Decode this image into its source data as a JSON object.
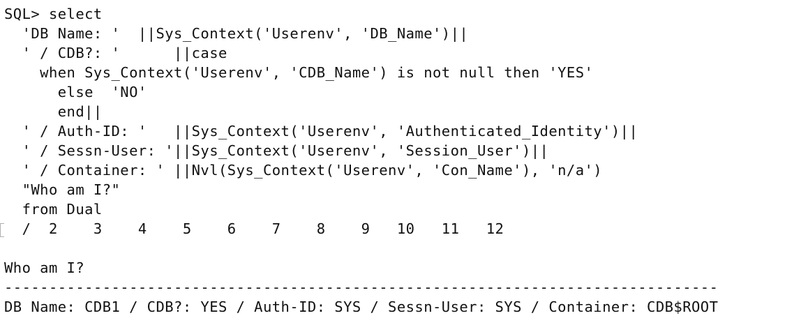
{
  "terminal": {
    "lines": [
      "SQL> select",
      "  'DB Name: '  ||Sys_Context('Userenv', 'DB_Name')||",
      "  ' / CDB?: '      ||case",
      "    when Sys_Context('Userenv', 'CDB_Name') is not null then 'YES'",
      "      else  'NO'",
      "      end||",
      "  ' / Auth-ID: '   ||Sys_Context('Userenv', 'Authenticated_Identity')||",
      "  ' / Sessn-User: '||Sys_Context('Userenv', 'Session_User')||",
      "  ' / Container: ' ||Nvl(Sys_Context('Userenv', 'Con_Name'), 'n/a')",
      "  \"Who am I?\"",
      "  from Dual",
      "  /  2    3    4    5    6    7    8    9   10   11   12",
      "",
      "Who am I?",
      "--------------------------------------------------------------------------------",
      "DB Name: CDB1 / CDB?: YES / Auth-ID: SYS / Sessn-User: SYS / Container: CDB$ROOT"
    ]
  }
}
